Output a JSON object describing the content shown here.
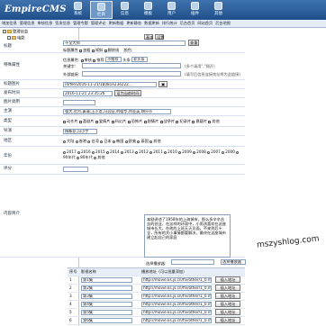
{
  "header": {
    "logo": "EmpireCMS",
    "nav": [
      "系统",
      "栏目",
      "信息",
      "模板",
      "用户",
      "插件",
      "其他"
    ],
    "active_nav": 1
  },
  "menubar": [
    "增加信息",
    "管理信息",
    "审核信息",
    "签发信息",
    "管理专题",
    "管理评论",
    "更新数据",
    "更新静态",
    "数据更新",
    "排行统计",
    "后台首页",
    "网站首页",
    "后台地图"
  ],
  "sidebar": {
    "root": "管理信息",
    "sections": [
      {
        "label": "电影",
        "items": [
          "动作片",
          "喜剧片",
          "爱情片",
          "科幻片",
          "战争片",
          "剧情片",
          "恐怖片",
          "纪录片"
        ]
      },
      {
        "label": "电视剧",
        "items": [
          "大陆剧",
          "港台剧",
          "日韩剧",
          "欧美剧"
        ]
      },
      {
        "label": "动漫",
        "items": []
      }
    ]
  },
  "form": {
    "top_tabs": [
      "基本",
      "设置"
    ],
    "labels": {
      "title": "标题",
      "special": "特殊属性",
      "title_pic": "标题图片",
      "publish_time": "发布时间",
      "pic": "图片调用",
      "tags": "主演",
      "type": "类型",
      "director": "导演",
      "area": "地区",
      "year": "年份",
      "rating": "评分",
      "intro": "内容简介"
    },
    "title_value": "十全大师",
    "title_button": "查重",
    "title_options": [
      "标题属性",
      "加粗",
      "倾斜",
      "删除线"
    ],
    "title_color_label": "颜色:",
    "special_options": [
      "信息属性:",
      "审核",
      "推荐",
      "不推荐",
      "头条",
      "非头条"
    ],
    "keyword_label": "关键字:",
    "keyword_hint": "(多个请用\",\"隔开)",
    "outer_label": "外部链接:",
    "outer_hint": "(填写后信息连接地址将为此链接)",
    "title_pic_value": "/d/file/2016-11-21/1b081e23e222...",
    "publish_value": "2016-11-21 23:35:26",
    "publish_button": "设为当前时间",
    "pic_value": "",
    "tags_value": "强大,对方,真诚,王小龙,冯远征,刘德华,刘亚英,胡莎莎",
    "type_options": [
      "动作片",
      "喜剧片",
      "爱情片",
      "科幻片",
      "恐怖片",
      "剧情片",
      "战争片",
      "纪录片",
      "悬疑片",
      "其他"
    ],
    "director_value": "杨新亚,冯小宁",
    "area_options": [
      "大陆",
      "香港",
      "台湾",
      "日本",
      "韩国",
      "欧美",
      "泰国",
      "其他"
    ],
    "year_options": [
      "2017",
      "2016",
      "2015",
      "2014",
      "2013",
      "2012",
      "2011",
      "2010",
      "2009",
      "2008",
      "2007",
      "2000",
      "90年代",
      "80年代",
      "其他"
    ],
    "intro_text": "本剧讲述了1958年的上海城市，那么多辛辛苦苦的创业，在这样的环境中，小男孩喜欢在这座城市长大，在他的上班天天见面，不来到后十全，所有的大小事情都要解决，最终在这座城市建立起自己的家庭",
    "watermark": "mszyshlog.com",
    "player_label": "选择播放器:",
    "player_select": "选择播放器",
    "player_options": [
      "选择播放器"
    ],
    "episodes_header": [
      "序号",
      "影视名称",
      "播放地址（可以批量添加）"
    ],
    "episodes": [
      {
        "num": "1",
        "name": "第1集",
        "url": "http://movie.ks.js.cn/flv/other/1_0.mp4",
        "btn": "插入地址"
      },
      {
        "num": "2",
        "name": "第2集",
        "url": "http://movie.ks.js.cn/flv/other/1_0.mp4",
        "btn": "插入地址"
      },
      {
        "num": "3",
        "name": "第3集",
        "url": "http://movie.ks.js.cn/flv/other/1_0.mp4",
        "btn": "插入地址"
      },
      {
        "num": "4",
        "name": "第4集",
        "url": "http://movie.ks.js.cn/flv/other/1_0.mp4",
        "btn": "插入地址"
      },
      {
        "num": "5",
        "name": "第5集",
        "url": "http://movie.ks.js.cn/flv/other/1_0.mp4",
        "btn": "插入地址"
      },
      {
        "num": "6",
        "name": "第6集",
        "url": "http://movie.ks.js.cn/flv/other/1_0.mp4",
        "btn": "插入地址"
      }
    ]
  }
}
